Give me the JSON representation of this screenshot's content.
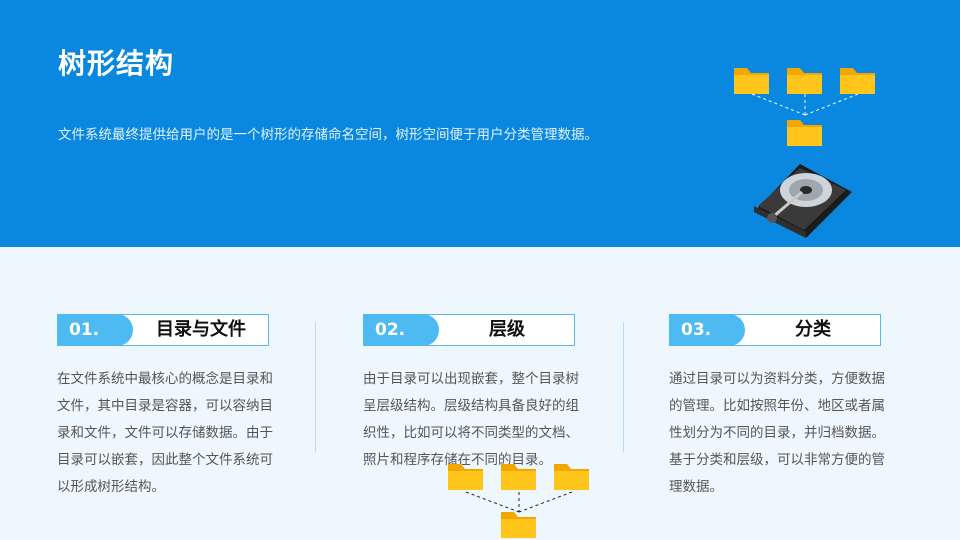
{
  "header": {
    "title": "树形结构",
    "intro": "文件系统最终提供给用户的是一个树形的存储命名空间，树形空间便于用户分类管理数据。"
  },
  "sections": [
    {
      "number": "01.",
      "title": "目录与文件",
      "body": "在文件系统中最核心的概念是目录和文件，其中目录是容器，可以容纳目录和文件，文件可以存储数据。由于目录可以嵌套，因此整个文件系统可以形成树形结构。"
    },
    {
      "number": "02.",
      "title": "层级",
      "body": "由于目录可以出现嵌套，整个目录树呈层级结构。层级结构具备良好的组织性，比如可以将不同类型的文档、照片和程序存储在不同的目录。"
    },
    {
      "number": "03.",
      "title": "分类",
      "body": "通过目录可以为资料分类，方便数据的管理。比如按照年份、地区或者属性划分为不同的目录，并归档数据。基于分类和层级，可以非常方便的管理数据。"
    }
  ],
  "icons": {
    "folder_tree": "folder-tree-icon",
    "hard_disk": "hard-disk-icon"
  },
  "colors": {
    "header_bg": "#0a88e0",
    "page_bg": "#eef7fd",
    "accent": "#4dbaf2",
    "folder": "#ffc51a"
  }
}
